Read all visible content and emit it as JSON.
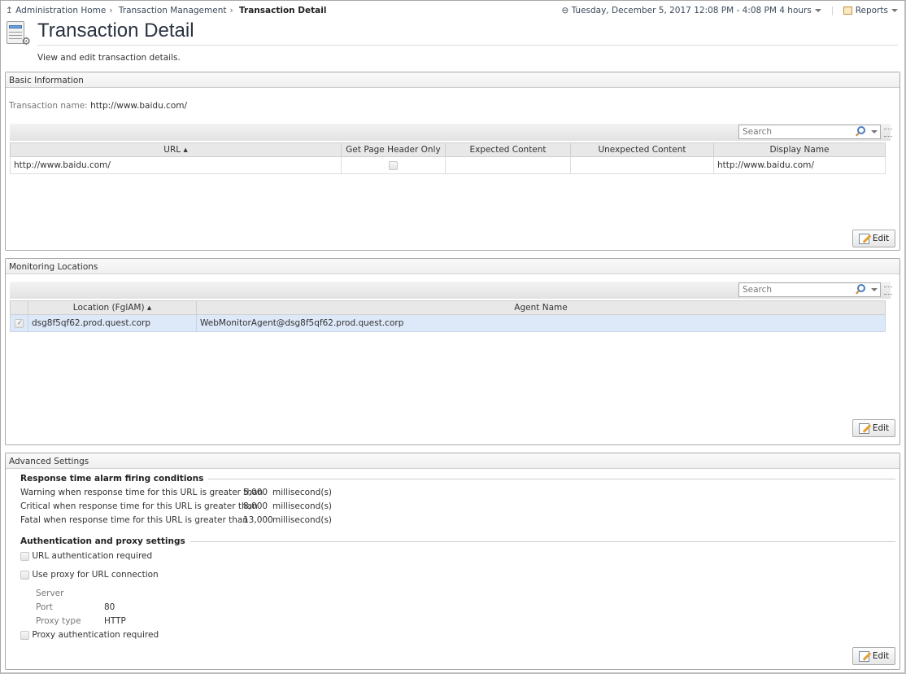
{
  "breadcrumb": {
    "items": [
      "Administration Home",
      "Transaction Management"
    ],
    "current": "Transaction Detail"
  },
  "header": {
    "time_range": "Tuesday, December 5, 2017 12:08 PM - 4:08 PM 4 hours",
    "reports": "Reports",
    "title": "Transaction Detail",
    "subtitle": "View and edit transaction details."
  },
  "basic": {
    "title": "Basic Information",
    "name_label": "Transaction name:",
    "name_value": "http://www.baidu.com/",
    "search_placeholder": "Search",
    "columns": [
      "URL",
      "Get Page Header Only",
      "Expected Content",
      "Unexpected Content",
      "Display Name"
    ],
    "rows": [
      {
        "url": "http://www.baidu.com/",
        "header_only": false,
        "expected": "",
        "unexpected": "",
        "display": "http://www.baidu.com/"
      }
    ],
    "edit": "Edit"
  },
  "monitoring": {
    "title": "Monitoring Locations",
    "search_placeholder": "Search",
    "columns": [
      "Location (FglAM)",
      "Agent Name"
    ],
    "rows": [
      {
        "checked": true,
        "location": "dsg8f5qf62.prod.quest.corp",
        "agent": "WebMonitorAgent@dsg8f5qf62.prod.quest.corp"
      }
    ],
    "edit": "Edit"
  },
  "advanced": {
    "title": "Advanced Settings",
    "alarm_title": "Response time alarm firing conditions",
    "alarms": [
      {
        "label": "Warning when response time for this URL is greater than",
        "value": "5,000",
        "unit": "millisecond(s)"
      },
      {
        "label": "Critical when response time for this URL is greater than",
        "value": "8,000",
        "unit": "millisecond(s)"
      },
      {
        "label": "Fatal when response time for this URL is greater than",
        "value": "13,000",
        "unit": "millisecond(s)"
      }
    ],
    "auth_title": "Authentication and proxy settings",
    "url_auth": "URL authentication required",
    "use_proxy": "Use proxy for URL connection",
    "server_label": "Server",
    "port_label": "Port",
    "port_value": "80",
    "proxy_type_label": "Proxy type",
    "proxy_type_value": "HTTP",
    "proxy_auth": "Proxy authentication required",
    "edit": "Edit"
  },
  "colors": {
    "selected_row": "#dde8f8",
    "header_text": "#2a3340"
  }
}
